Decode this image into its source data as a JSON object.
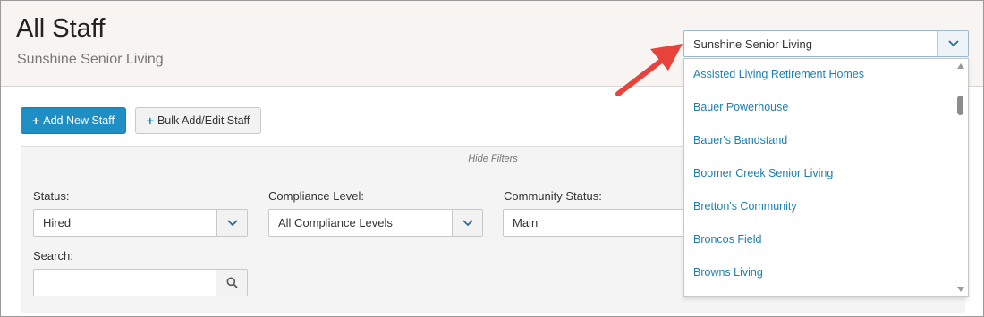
{
  "header": {
    "title": "All Staff",
    "subtitle": "Sunshine Senior Living"
  },
  "toolbar": {
    "add_label": "Add New Staff",
    "bulk_label": "Bulk Add/Edit Staff"
  },
  "filters": {
    "hide_label": "Hide Filters",
    "status": {
      "label": "Status:",
      "value": "Hired"
    },
    "compliance": {
      "label": "Compliance Level:",
      "value": "All Compliance Levels"
    },
    "community_status": {
      "label": "Community Status:",
      "value": "Main"
    },
    "search": {
      "label": "Search:",
      "value": ""
    }
  },
  "community_select": {
    "value": "Sunshine Senior Living",
    "options": [
      "Assisted Living Retirement Homes",
      "Bauer Powerhouse",
      "Bauer's Bandstand",
      "Boomer Creek Senior Living",
      "Bretton's Community",
      "Broncos Field",
      "Browns Living"
    ]
  },
  "colors": {
    "primary": "#1f8ec5",
    "link": "#1d7fae",
    "annotation_arrow": "#e8423c"
  }
}
